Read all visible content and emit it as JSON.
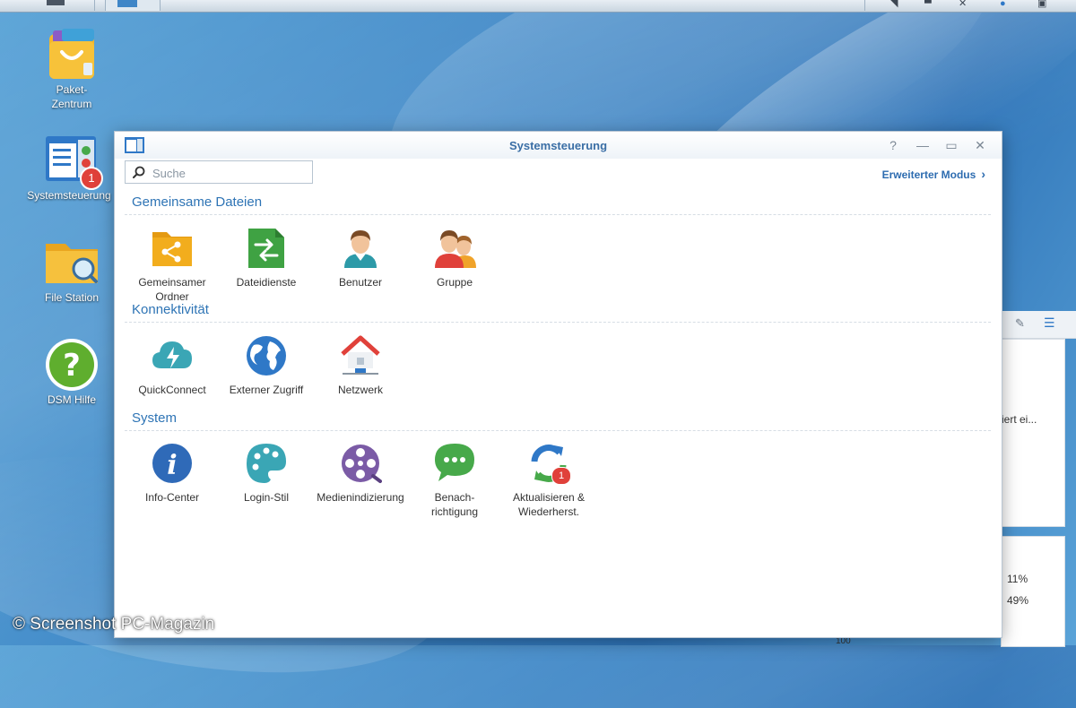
{
  "desktop": {
    "icons": [
      {
        "label": "Paket-\nZentrum"
      },
      {
        "label": "Systemsteuerung",
        "badge": "1"
      },
      {
        "label": "File Station"
      },
      {
        "label": "DSM Hilfe"
      }
    ]
  },
  "window": {
    "title": "Systemsteuerung",
    "search_placeholder": "Suche",
    "advanced_mode": "Erweiterter Modus",
    "sections": [
      {
        "title": "Gemeinsame Dateien",
        "items": [
          {
            "label": "Gemeinsamer Ordner",
            "icon": "shared-folder-icon"
          },
          {
            "label": "Dateidienste",
            "icon": "file-services-icon"
          },
          {
            "label": "Benutzer",
            "icon": "user-icon"
          },
          {
            "label": "Gruppe",
            "icon": "group-icon"
          }
        ]
      },
      {
        "title": "Konnektivität",
        "items": [
          {
            "label": "QuickConnect",
            "icon": "quickconnect-icon"
          },
          {
            "label": "Externer Zugriff",
            "icon": "globe-icon"
          },
          {
            "label": "Netzwerk",
            "icon": "network-house-icon"
          }
        ]
      },
      {
        "title": "System",
        "items": [
          {
            "label": "Info-Center",
            "icon": "info-icon"
          },
          {
            "label": "Login-Stil",
            "icon": "palette-icon"
          },
          {
            "label": "Medienindizierung",
            "icon": "film-reel-icon"
          },
          {
            "label": "Benach-\nrichtigung",
            "icon": "chat-bubble-icon"
          },
          {
            "label": "Aktualisieren &\nWiederherst.",
            "icon": "update-icon",
            "badge": "1"
          }
        ]
      }
    ]
  },
  "widget": {
    "text_partial": "iert ei...",
    "value_1": "11%",
    "value_2": "49%",
    "value_3": "100"
  },
  "copyright": "© Screenshot PC-Magazin",
  "colors": {
    "accent": "#2e74b5",
    "badge": "#e0413a"
  }
}
